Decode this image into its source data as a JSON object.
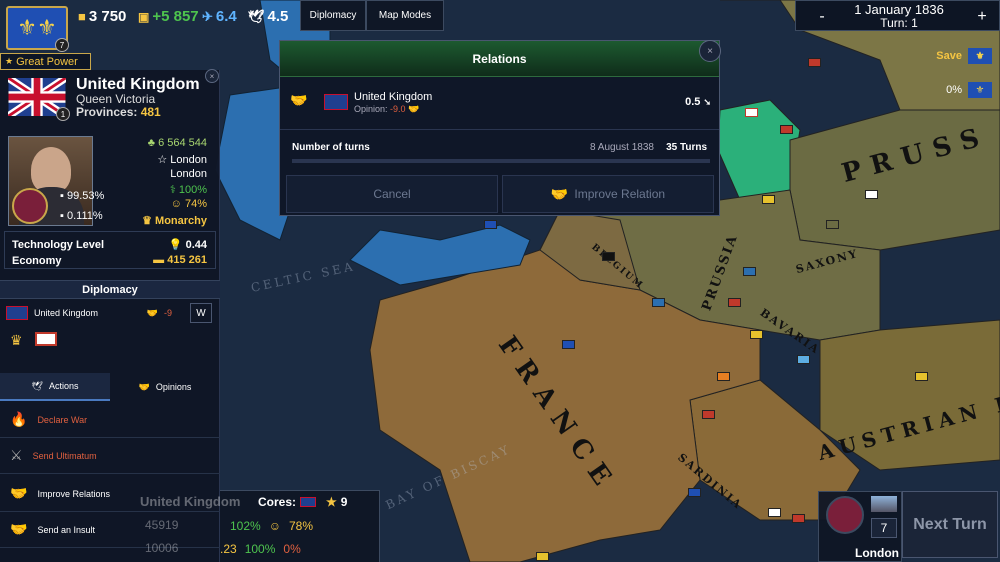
{
  "topbar": {
    "gold": "3 750",
    "income": "+5 857",
    "manpower": "6.4",
    "prestige": "4.5",
    "coat_badge": "7",
    "diplomacy_label": "Diplomacy",
    "mapmodes_label": "Map Modes"
  },
  "date": {
    "date_text": "1 January 1836",
    "turn_text": "Turn: 1",
    "minus": "-",
    "plus": "+"
  },
  "right_tools": {
    "save_label": "Save",
    "percent": "0%"
  },
  "country_panel": {
    "tag": "Great Power",
    "name": "United Kingdom",
    "ruler": "Queen Victoria",
    "provinces_label": "Provinces:",
    "provinces_value": "481",
    "flag_badge": "1",
    "population": "6 564 544",
    "capital_1": "London",
    "capital_2": "London",
    "stability": "100%",
    "happiness": "74%",
    "government": "Monarchy",
    "culture_pct": "99.53%",
    "other_pct": "0.111%",
    "tech_label": "Technology Level",
    "tech_value": "0.44",
    "economy_label": "Economy",
    "economy_value": "415 261"
  },
  "diplomacy": {
    "header": "Diplomacy",
    "country": "United Kingdom",
    "relation_value": "-9"
  },
  "tabs": {
    "actions": "Actions",
    "opinions": "Opinions"
  },
  "actions": [
    {
      "label": "Declare War"
    },
    {
      "label": "Send Ultimatum"
    },
    {
      "label": "Improve Relations"
    },
    {
      "label": "Send an Insult"
    }
  ],
  "bottom_info": {
    "country": "United Kingdom",
    "cores_label": "Cores:",
    "stars": "9",
    "num1": "45919",
    "num2": "10006",
    "pct1": "102%",
    "pct2": "78%",
    "val1": ".23",
    "pct3": "100%",
    "pct4": "0%"
  },
  "city": {
    "badge": "7",
    "name": "London"
  },
  "next_turn": "Next Turn",
  "dialog": {
    "title": "Relations",
    "country": "United Kingdom",
    "opinion_label": "Opinion:",
    "opinion_value": "-9.0",
    "right_value": "0.5",
    "turns_label": "Number of turns",
    "turns_date": "8 August 1838",
    "turns_value": "35 Turns",
    "cancel": "Cancel",
    "improve": "Improve Relation"
  },
  "map_labels": {
    "france": "FRANCE",
    "prussia_big": "PRUSS",
    "prussia": "PRUSSIA",
    "saxony": "SAXONY",
    "bavaria": "BAVARIA",
    "belgium": "BELGIUM",
    "sardinia": "SARDINIA",
    "austrian": "AUSTRIAN E"
  },
  "colors": {
    "uk_blue": "#2c6fb0",
    "france": "#8e6a3a",
    "prussia": "#6b6b43",
    "denmark_green": "#2bb07a",
    "accent_gold": "#f5c542",
    "positive_green": "#4ec44e",
    "negative_red": "#e0603f"
  }
}
